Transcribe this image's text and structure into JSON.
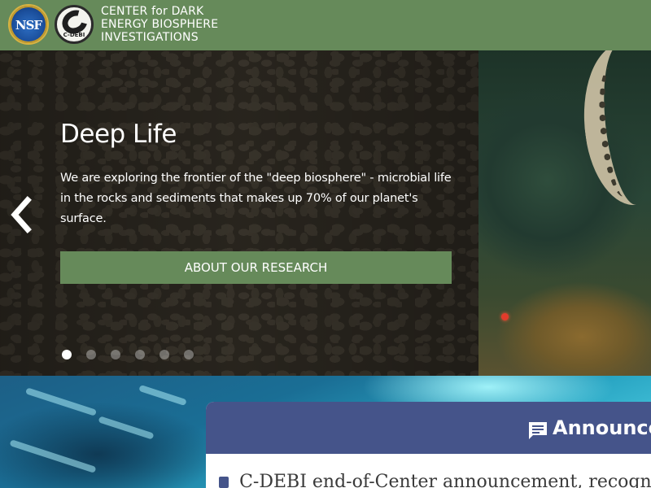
{
  "header": {
    "nsf_logo_text": "NSF",
    "cdebi_logo_text": "C-DEBI",
    "title_lines": [
      "CENTER for DARK",
      "ENERGY BIOSPHERE",
      "INVESTIGATIONS"
    ],
    "background_color": "#668a5a"
  },
  "hero": {
    "title": "Deep Life",
    "description": "We are exploring the frontier of the \"deep biosphere\" - microbial life in the rocks and sediments that makes up 70% of our planet's surface.",
    "button_label": "ABOUT OUR RESEARCH",
    "prev_icon": "chevron-left-icon",
    "slide_count": 6,
    "active_slide": 1,
    "accent_color": "#668a5a"
  },
  "announcements": {
    "icon": "message-icon",
    "title": "Announcements",
    "items": [
      {
        "icon": "document-icon",
        "label": "C-DEBI end-of-Center announcement, recognitions"
      }
    ],
    "header_color": "#45548a"
  }
}
